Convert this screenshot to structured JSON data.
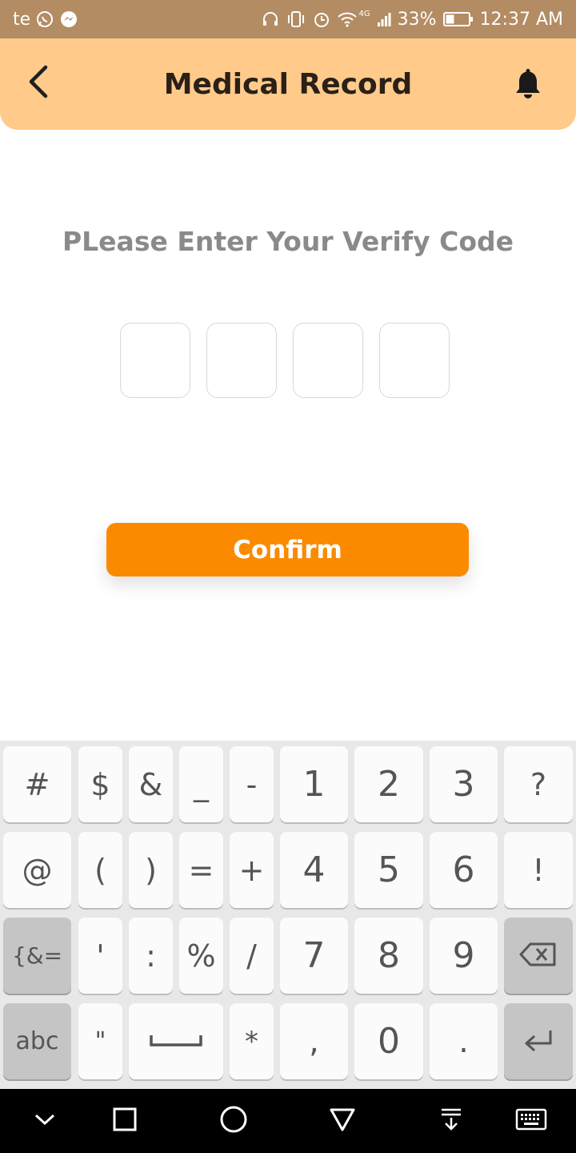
{
  "status_bar": {
    "carrier": "te",
    "network": "4G",
    "battery": "33%",
    "time": "12:37 AM",
    "icons": [
      "whatsapp-icon",
      "messenger-icon",
      "headphones-icon",
      "vibrate-icon",
      "alarm-icon",
      "wifi-icon",
      "signal-icon",
      "battery-icon"
    ]
  },
  "header": {
    "title": "Medical Record",
    "back_icon": "chevron-left-icon",
    "bell_icon": "bell-icon"
  },
  "verify": {
    "prompt": "PLease Enter Your Verify Code",
    "code_digits": [
      "",
      "",
      "",
      ""
    ]
  },
  "confirm_label": "Confirm",
  "keyboard": {
    "row1": [
      "#",
      "$",
      "&",
      "_",
      "-",
      "1",
      "2",
      "3",
      "?"
    ],
    "row2": [
      "@",
      "(",
      ")",
      "=",
      "+",
      "4",
      "5",
      "6",
      "!"
    ],
    "row3": [
      "{&=",
      "'",
      ":",
      "%",
      "/",
      "7",
      "8",
      "9"
    ],
    "row3_backspace_icon": "backspace-icon",
    "row4": [
      "abc",
      "\"",
      "*",
      ",",
      "0",
      "."
    ],
    "row4_space_icon": "space-icon",
    "row4_enter_icon": "enter-icon"
  },
  "nav_bar": {
    "icons": [
      "hide-keyboard-icon",
      "recents-icon",
      "home-icon",
      "back-icon",
      "notification-pull-icon",
      "keyboard-icon"
    ]
  },
  "colors": {
    "status_bar": "#b38c63",
    "header": "#ffca8a",
    "accent": "#fb8a00",
    "prompt_text": "#8a8a8a"
  }
}
